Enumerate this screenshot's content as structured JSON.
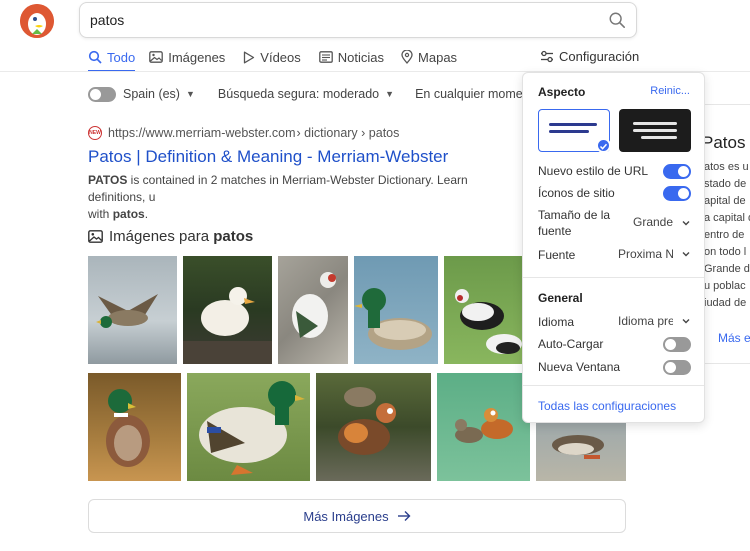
{
  "search": {
    "query": "patos"
  },
  "nav": {
    "tabs": [
      {
        "label": "Todo",
        "icon": "search-icon",
        "active": true
      },
      {
        "label": "Imágenes",
        "icon": "image-icon"
      },
      {
        "label": "Vídeos",
        "icon": "play-icon"
      },
      {
        "label": "Noticias",
        "icon": "newspaper-icon"
      },
      {
        "label": "Mapas",
        "icon": "map-pin-icon"
      }
    ],
    "settings_label": "Configuración"
  },
  "filters": {
    "region": "Spain (es)",
    "safe_search": "Búsqueda segura: moderado",
    "time": "En cualquier momento"
  },
  "result": {
    "favicon_text": "NEW",
    "url": "https://www.merriam-webster.com",
    "breadcrumb": " › dictionary › patos",
    "title": "Patos | Definition & Meaning - Merriam-Webster",
    "snippet_bold": "PATOS",
    "snippet_text": " is contained in 2 matches in Merriam-Webster Dictionary. Learn definitions, u",
    "snippet_line2_prefix": "with ",
    "snippet_line2_bold": "patos",
    "snippet_line2_suffix": "."
  },
  "images": {
    "heading_prefix": "Imágenes para ",
    "heading_bold": "patos",
    "more_label": "Más Imágenes"
  },
  "side_panel": {
    "title": "Patos",
    "lines": [
      "atos es u",
      "stado de",
      "apital de",
      "a capital d",
      "entro de",
      "on todo l",
      "Grande d",
      "u poblac",
      "iudad de"
    ],
    "more": "Más e"
  },
  "settings": {
    "aspect_label": "Aspecto",
    "reset_label": "Reinic...",
    "rows": [
      {
        "label": "Nuevo estilo de URL",
        "type": "toggle",
        "on": true
      },
      {
        "label": "Íconos de sitio",
        "type": "toggle",
        "on": true
      },
      {
        "label": "Tamaño de la fuente",
        "type": "select",
        "value": "Grande"
      },
      {
        "label": "Fuente",
        "type": "select",
        "value": "Proxima Nova"
      }
    ],
    "general_label": "General",
    "general_rows": [
      {
        "label": "Idioma",
        "type": "select",
        "value": "Idioma predeterminado"
      },
      {
        "label": "Auto-Cargar",
        "type": "toggle",
        "on": false
      },
      {
        "label": "Nueva Ventana",
        "type": "toggle",
        "on": false
      }
    ],
    "all_settings": "Todas las configuraciones"
  },
  "colors": {
    "accent": "#3969ef",
    "link": "#1f50c9",
    "brand": "#de5833"
  }
}
